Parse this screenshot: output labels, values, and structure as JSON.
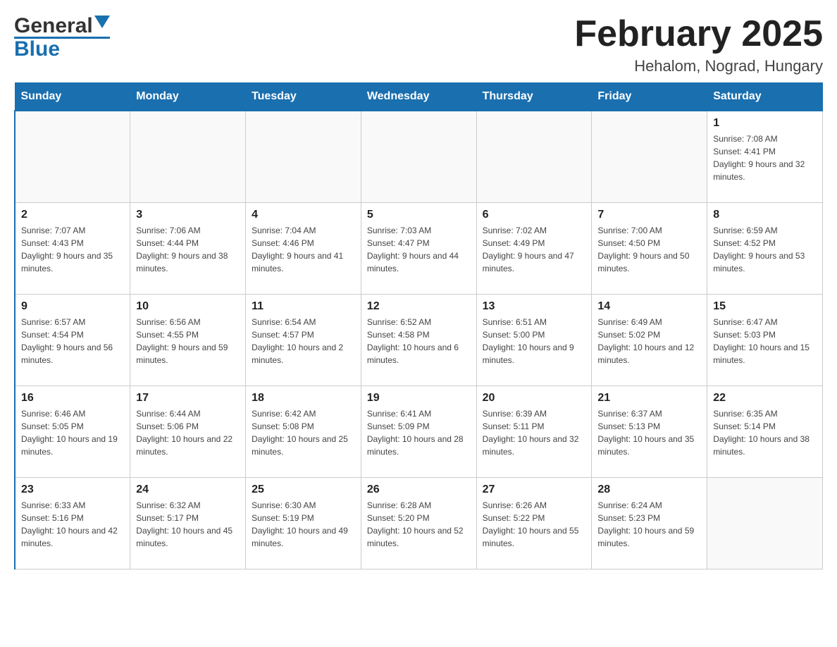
{
  "header": {
    "logo_general": "General",
    "logo_blue": "Blue",
    "title": "February 2025",
    "subtitle": "Hehalom, Nograd, Hungary"
  },
  "days_of_week": [
    "Sunday",
    "Monday",
    "Tuesday",
    "Wednesday",
    "Thursday",
    "Friday",
    "Saturday"
  ],
  "weeks": [
    [
      {
        "day": "",
        "info": ""
      },
      {
        "day": "",
        "info": ""
      },
      {
        "day": "",
        "info": ""
      },
      {
        "day": "",
        "info": ""
      },
      {
        "day": "",
        "info": ""
      },
      {
        "day": "",
        "info": ""
      },
      {
        "day": "1",
        "info": "Sunrise: 7:08 AM\nSunset: 4:41 PM\nDaylight: 9 hours and 32 minutes."
      }
    ],
    [
      {
        "day": "2",
        "info": "Sunrise: 7:07 AM\nSunset: 4:43 PM\nDaylight: 9 hours and 35 minutes."
      },
      {
        "day": "3",
        "info": "Sunrise: 7:06 AM\nSunset: 4:44 PM\nDaylight: 9 hours and 38 minutes."
      },
      {
        "day": "4",
        "info": "Sunrise: 7:04 AM\nSunset: 4:46 PM\nDaylight: 9 hours and 41 minutes."
      },
      {
        "day": "5",
        "info": "Sunrise: 7:03 AM\nSunset: 4:47 PM\nDaylight: 9 hours and 44 minutes."
      },
      {
        "day": "6",
        "info": "Sunrise: 7:02 AM\nSunset: 4:49 PM\nDaylight: 9 hours and 47 minutes."
      },
      {
        "day": "7",
        "info": "Sunrise: 7:00 AM\nSunset: 4:50 PM\nDaylight: 9 hours and 50 minutes."
      },
      {
        "day": "8",
        "info": "Sunrise: 6:59 AM\nSunset: 4:52 PM\nDaylight: 9 hours and 53 minutes."
      }
    ],
    [
      {
        "day": "9",
        "info": "Sunrise: 6:57 AM\nSunset: 4:54 PM\nDaylight: 9 hours and 56 minutes."
      },
      {
        "day": "10",
        "info": "Sunrise: 6:56 AM\nSunset: 4:55 PM\nDaylight: 9 hours and 59 minutes."
      },
      {
        "day": "11",
        "info": "Sunrise: 6:54 AM\nSunset: 4:57 PM\nDaylight: 10 hours and 2 minutes."
      },
      {
        "day": "12",
        "info": "Sunrise: 6:52 AM\nSunset: 4:58 PM\nDaylight: 10 hours and 6 minutes."
      },
      {
        "day": "13",
        "info": "Sunrise: 6:51 AM\nSunset: 5:00 PM\nDaylight: 10 hours and 9 minutes."
      },
      {
        "day": "14",
        "info": "Sunrise: 6:49 AM\nSunset: 5:02 PM\nDaylight: 10 hours and 12 minutes."
      },
      {
        "day": "15",
        "info": "Sunrise: 6:47 AM\nSunset: 5:03 PM\nDaylight: 10 hours and 15 minutes."
      }
    ],
    [
      {
        "day": "16",
        "info": "Sunrise: 6:46 AM\nSunset: 5:05 PM\nDaylight: 10 hours and 19 minutes."
      },
      {
        "day": "17",
        "info": "Sunrise: 6:44 AM\nSunset: 5:06 PM\nDaylight: 10 hours and 22 minutes."
      },
      {
        "day": "18",
        "info": "Sunrise: 6:42 AM\nSunset: 5:08 PM\nDaylight: 10 hours and 25 minutes."
      },
      {
        "day": "19",
        "info": "Sunrise: 6:41 AM\nSunset: 5:09 PM\nDaylight: 10 hours and 28 minutes."
      },
      {
        "day": "20",
        "info": "Sunrise: 6:39 AM\nSunset: 5:11 PM\nDaylight: 10 hours and 32 minutes."
      },
      {
        "day": "21",
        "info": "Sunrise: 6:37 AM\nSunset: 5:13 PM\nDaylight: 10 hours and 35 minutes."
      },
      {
        "day": "22",
        "info": "Sunrise: 6:35 AM\nSunset: 5:14 PM\nDaylight: 10 hours and 38 minutes."
      }
    ],
    [
      {
        "day": "23",
        "info": "Sunrise: 6:33 AM\nSunset: 5:16 PM\nDaylight: 10 hours and 42 minutes."
      },
      {
        "day": "24",
        "info": "Sunrise: 6:32 AM\nSunset: 5:17 PM\nDaylight: 10 hours and 45 minutes."
      },
      {
        "day": "25",
        "info": "Sunrise: 6:30 AM\nSunset: 5:19 PM\nDaylight: 10 hours and 49 minutes."
      },
      {
        "day": "26",
        "info": "Sunrise: 6:28 AM\nSunset: 5:20 PM\nDaylight: 10 hours and 52 minutes."
      },
      {
        "day": "27",
        "info": "Sunrise: 6:26 AM\nSunset: 5:22 PM\nDaylight: 10 hours and 55 minutes."
      },
      {
        "day": "28",
        "info": "Sunrise: 6:24 AM\nSunset: 5:23 PM\nDaylight: 10 hours and 59 minutes."
      },
      {
        "day": "",
        "info": ""
      }
    ]
  ]
}
